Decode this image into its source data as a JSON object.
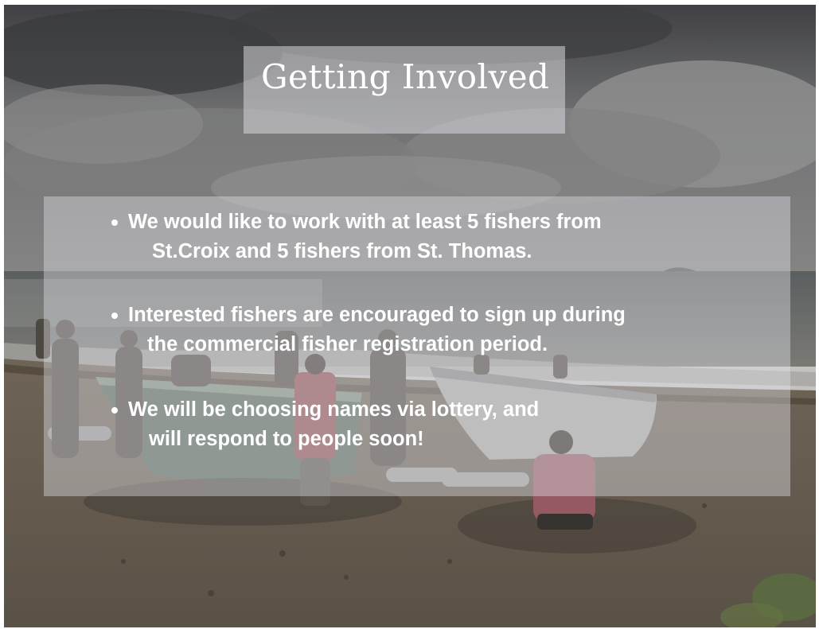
{
  "slide": {
    "title": "Getting Involved",
    "bullets": [
      {
        "line1": "We would like to work with at least 5 fishers from",
        "line2": "St.Croix and 5 fishers from St. Thomas."
      },
      {
        "line1": "Interested fishers are encouraged to sign up during",
        "line2": "the commercial fisher registration period."
      },
      {
        "line1": "We will be choosing names via lottery, and",
        "line2": "will respond to people soon!"
      }
    ]
  }
}
